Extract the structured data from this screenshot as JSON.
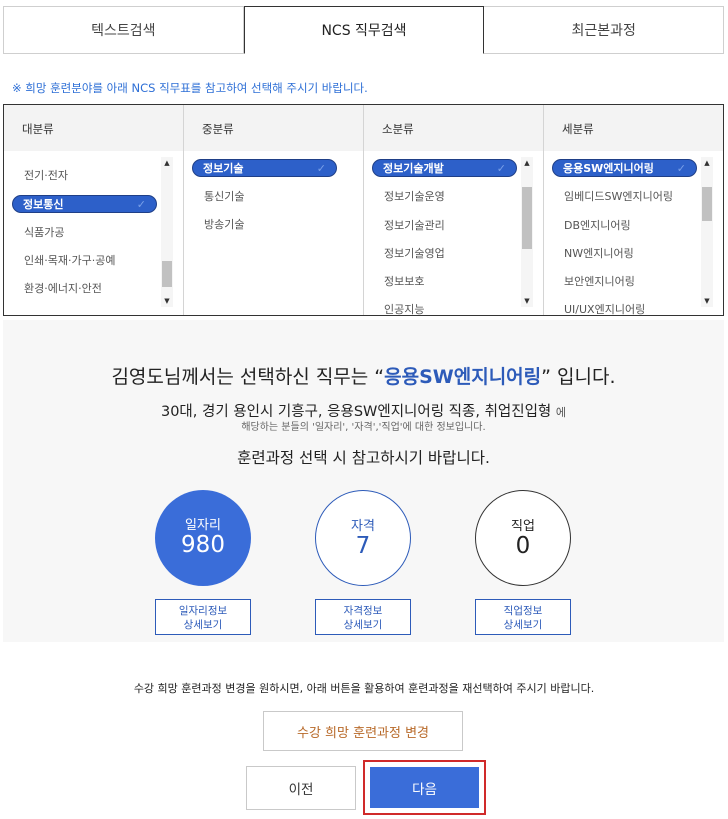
{
  "tabs": [
    {
      "label": "텍스트검색"
    },
    {
      "label": "NCS 직무검색"
    },
    {
      "label": "최근본과정"
    }
  ],
  "notice": "※ 희망 훈련분야를 아래 NCS 직무표를 참고하여 선택해 주시기 바랍니다.",
  "categories": {
    "major": {
      "header": "대분류",
      "items": [
        "전기·전자",
        "정보통신",
        "식품가공",
        "인쇄·목재·가구·공예",
        "환경·에너지·안전"
      ],
      "selected": "정보통신"
    },
    "middle": {
      "header": "중분류",
      "items": [
        "정보기술",
        "통신기술",
        "방송기술"
      ],
      "selected": "정보기술"
    },
    "minor": {
      "header": "소분류",
      "items": [
        "정보기술개발",
        "정보기술운영",
        "정보기술관리",
        "정보기술영업",
        "정보보호",
        "인공지능"
      ],
      "selected": "정보기술개발"
    },
    "detail": {
      "header": "세분류",
      "items": [
        "응용SW엔지니어링",
        "임베디드SW엔지니어링",
        "DB엔지니어링",
        "NW엔지니어링",
        "보안엔지니어링",
        "UI/UX엔지니어링"
      ],
      "selected": "응용SW엔지니어링"
    }
  },
  "summary": {
    "prefix": "김영도님께서는 선택하신 직무는 “",
    "job": "응용SW엔지니어링",
    "suffix": "” 입니다.",
    "profile": "30대, 경기 용인시 기흥구, 응용SW엔지니어링 직종, 취업진입형",
    "profile_suffix": "에",
    "sub": "해당하는 분들의 '일자리', '자격','직업'에 대한 정보입니다.",
    "guide": "훈련과정 선택 시 참고하시기 바랍니다."
  },
  "stats": [
    {
      "label": "일자리",
      "value": "980",
      "detail_line1": "일자리정보",
      "detail_line2": "상세보기"
    },
    {
      "label": "자격",
      "value": "7",
      "detail_line1": "자격정보",
      "detail_line2": "상세보기"
    },
    {
      "label": "직업",
      "value": "0",
      "detail_line1": "직업정보",
      "detail_line2": "상세보기"
    }
  ],
  "change_note": "수강 희망 훈련과정 변경을 원하시면, 아래 버튼을 활용하여 훈련과정을 재선택하여 주시기 바랍니다.",
  "change_button": "수강 희망 훈련과정 변경",
  "prev_button": "이전",
  "next_button": "다음",
  "colors": {
    "accent": "#3a6dd9",
    "highlight": "#2d5bb9",
    "focus_border": "#d02a2a"
  }
}
